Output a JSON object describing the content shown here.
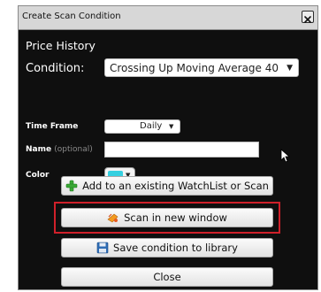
{
  "dialog": {
    "title": "Create Scan Condition",
    "close_glyph": "X",
    "section_heading": "Price History",
    "condition": {
      "label": "Condition:",
      "value": "Crossing Up Moving Average 40"
    },
    "time_frame": {
      "label": "Time Frame",
      "value": "Daily"
    },
    "name": {
      "label": "Name",
      "optional_hint": "(optional)",
      "value": ""
    },
    "color": {
      "label": "Color",
      "value": "#35d0e0"
    },
    "buttons": {
      "add_watchlist": {
        "label": "Add to an existing WatchList or Scan",
        "icon": "green-plus-icon"
      },
      "scan_new_window": {
        "label": "Scan in new window",
        "icon": "scan-icon"
      },
      "save_library": {
        "label": "Save condition to library",
        "icon": "floppy-disk-icon"
      },
      "close": {
        "label": "Close"
      }
    },
    "highlight_color": "#d0202a"
  }
}
